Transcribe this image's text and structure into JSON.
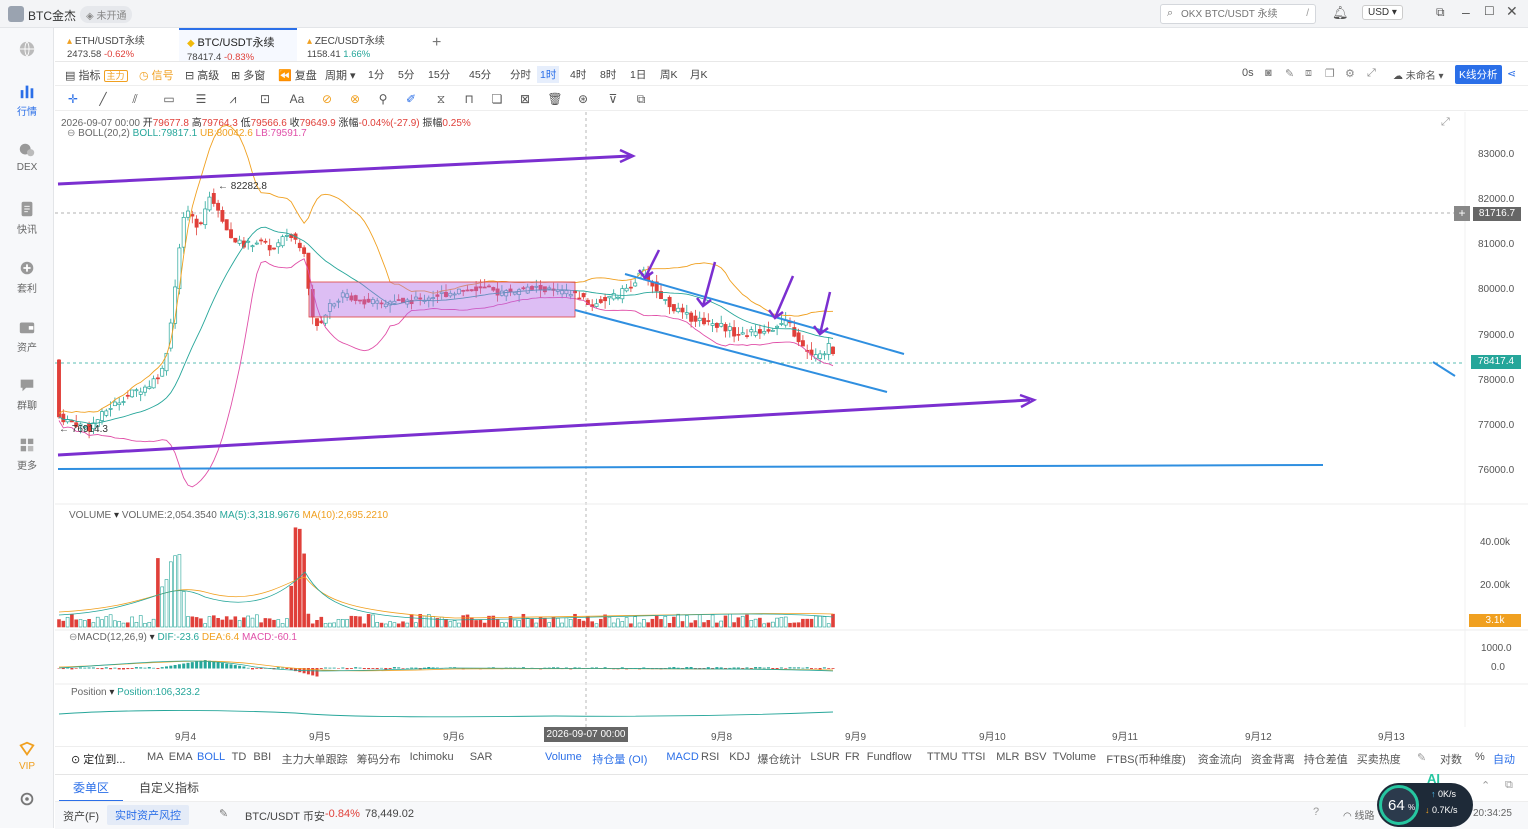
{
  "app": {
    "title": "BTC金杰",
    "badge": "未开通"
  },
  "search": {
    "placeholder": "OKX BTC/USDT 永续",
    "shortcut": "/"
  },
  "currency": "USD",
  "sidebar": {
    "items": [
      {
        "label": "",
        "icon": "globe-icon"
      },
      {
        "label": "行情",
        "icon": "chart-bar-icon"
      },
      {
        "label": "DEX",
        "icon": "dex-icon"
      },
      {
        "label": "快讯",
        "icon": "news-icon"
      },
      {
        "label": "套利",
        "icon": "arbitrage-icon"
      },
      {
        "label": "资产",
        "icon": "wallet-icon"
      },
      {
        "label": "群聊",
        "icon": "chat-icon"
      },
      {
        "label": "更多",
        "icon": "grid-icon"
      }
    ],
    "vip": "VIP"
  },
  "tabs": [
    {
      "name": "ETH/USDT永续",
      "price": "2473.58",
      "change": "-0.62%"
    },
    {
      "name": "BTC/USDT永续",
      "price": "78417.4",
      "change": "-0.83%"
    },
    {
      "name": "ZEC/USDT永续",
      "price": "1158.41",
      "change": "1.66%"
    }
  ],
  "toolbar": {
    "indicator": "指标",
    "indicator_tag": "主力",
    "signal": "信号",
    "advanced": "高级",
    "multi": "多窗",
    "replay": "复盘",
    "period": "周期",
    "intervals": [
      "1分",
      "5分",
      "15分",
      "45分",
      "分时",
      "1时",
      "4时",
      "8时",
      "1日",
      "周K",
      "月K"
    ],
    "active_interval": "1时",
    "countdown": "0s",
    "unnamed": "未命名",
    "kline_analysis": "K线分析"
  },
  "ohlc": {
    "date": "2026-09-07 00:00",
    "open_l": "开",
    "open": "79677.8",
    "high_l": "高",
    "high": "79764.3",
    "low_l": "低",
    "low": "79566.6",
    "close_l": "收",
    "close": "79649.9",
    "chg_l": "涨幅",
    "chg": "-0.04%(-27.9)",
    "amp_l": "振幅",
    "amp": "0.25%"
  },
  "boll": {
    "name": "BOLL(20,2)",
    "mid": "BOLL:79817.1",
    "ub": "UB:80042.6",
    "lb": "LB:79591.7"
  },
  "volume": {
    "name": "VOLUME",
    "value": "VOLUME:2,054.3540",
    "ma5": "MA(5):3,318.9676",
    "ma10": "MA(10):2,695.2210",
    "tag": "3.1k"
  },
  "macd": {
    "name": "MACD(12,26,9)",
    "dif": "DIF:-23.6",
    "dea": "DEA:6.4",
    "macd": "MACD:-60.1"
  },
  "position": {
    "name": "Position",
    "value": "Position:106,323.2"
  },
  "annotations": {
    "high": "82282.8",
    "low": "76914.3",
    "crosshair_price": "81716.7",
    "last_price": "78417.4",
    "crosshair_date": "2026-09-07 00:00"
  },
  "chart_data": {
    "type": "candlestick",
    "price_axis": {
      "ticks": [
        "83000.0",
        "82000.0",
        "81000.0",
        "80000.0",
        "79000.0",
        "78000.0",
        "77000.0",
        "76000.0"
      ],
      "range": [
        75400,
        83600
      ]
    },
    "volume_axis": {
      "ticks": [
        "40.00k",
        "20.00k"
      ]
    },
    "macd_axis": {
      "ticks": [
        "1000.0",
        "0.0"
      ]
    },
    "x_ticks": [
      "9月4",
      "9月5",
      "9月6",
      "9月7",
      "9月8",
      "9月9",
      "9月10",
      "9月11",
      "9月12",
      "9月13"
    ]
  },
  "bottom": {
    "locate": "定位到...",
    "left_items": [
      "MA",
      "EMA",
      "BOLL",
      "TD",
      "BBI",
      "主力大单跟踪",
      "筹码分布",
      "Ichimoku",
      "SAR"
    ],
    "right_items": [
      "Volume",
      "持仓量 (OI)",
      "MACD",
      "RSI",
      "KDJ",
      "爆仓统计",
      "LSUR",
      "FR",
      "Fundflow",
      "TTMU",
      "TTSI",
      "MLR",
      "BSV",
      "TVolume",
      "FTBS(币种维度)",
      "资金流向",
      "资金背离",
      "持仓差值",
      "买卖热度"
    ],
    "log": "对数",
    "pct": "%",
    "auto": "自动"
  },
  "panel": {
    "tabs": [
      "委单区",
      "自定义指标"
    ],
    "assets": "资产(F)",
    "risk": "实时资产风控",
    "ticker": "BTC/USDT 币安",
    "ticker_change": "-0.84%",
    "ticker_price": "78,449.02",
    "cpu": "64",
    "up": "0K/s",
    "down": "0.7K/s",
    "time": "20:34:25",
    "ai": "AI",
    "net": "线路"
  },
  "colors": {
    "up": "#26a69a",
    "down": "#e0403a",
    "accent": "#2b6fe8",
    "purple": "#7b2fd0",
    "line_blue": "#2f8fe0"
  }
}
